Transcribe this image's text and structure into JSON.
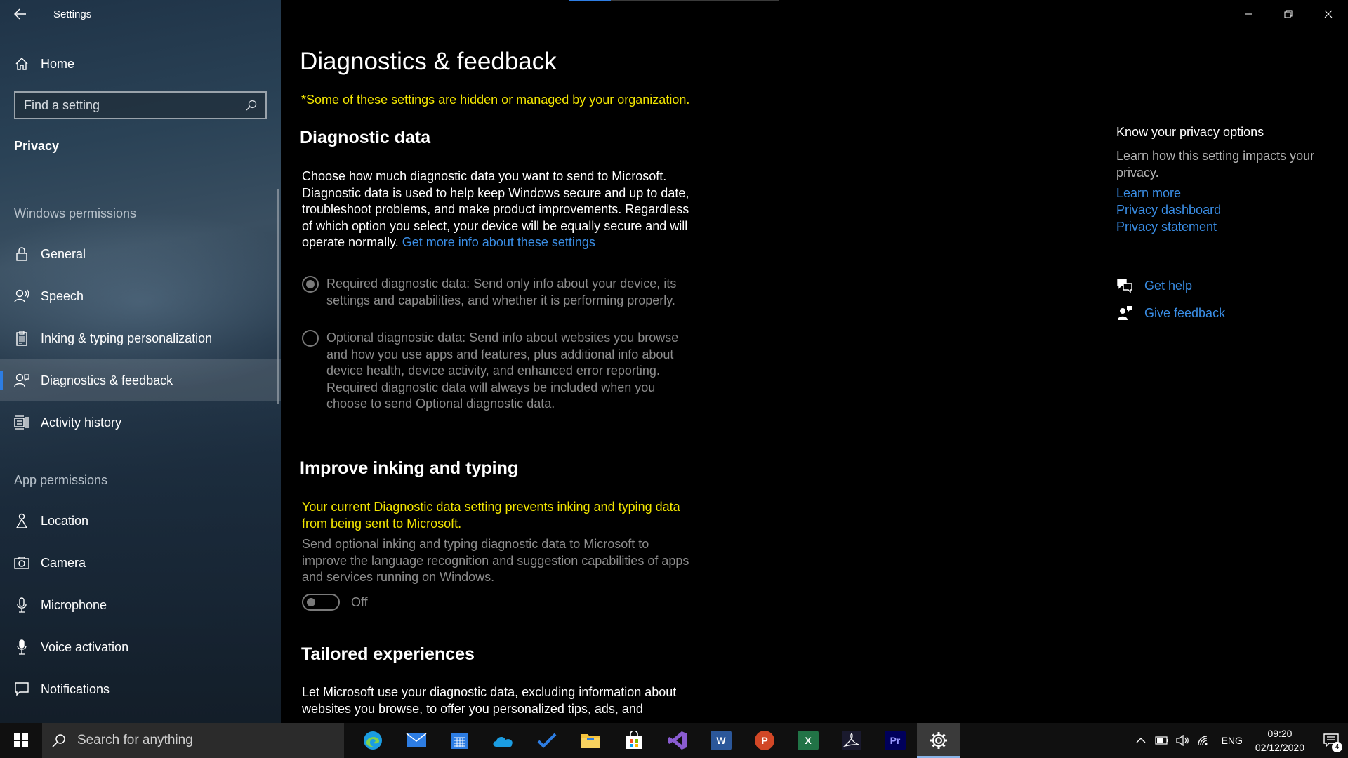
{
  "window": {
    "app_title": "Settings"
  },
  "sidebar": {
    "home_label": "Home",
    "search_placeholder": "Find a setting",
    "current_section": "Privacy",
    "group1_label": "Windows permissions",
    "group1_items": [
      {
        "label": "General",
        "icon": "lock-icon"
      },
      {
        "label": "Speech",
        "icon": "speech-icon"
      },
      {
        "label": "Inking & typing personalization",
        "icon": "clipboard-icon"
      },
      {
        "label": "Diagnostics & feedback",
        "icon": "diagnostics-icon",
        "active": true
      },
      {
        "label": "Activity history",
        "icon": "activity-history-icon"
      }
    ],
    "group2_label": "App permissions",
    "group2_items": [
      {
        "label": "Location",
        "icon": "location-icon"
      },
      {
        "label": "Camera",
        "icon": "camera-icon"
      },
      {
        "label": "Microphone",
        "icon": "microphone-icon"
      },
      {
        "label": "Voice activation",
        "icon": "voice-activation-icon"
      },
      {
        "label": "Notifications",
        "icon": "notifications-icon"
      }
    ]
  },
  "main": {
    "title": "Diagnostics & feedback",
    "managed_warning": "*Some of these settings are hidden or managed by your organization.",
    "diagnostic": {
      "heading": "Diagnostic data",
      "description": "Choose how much diagnostic data you want to send to Microsoft. Diagnostic data is used to help keep Windows secure and up to date, troubleshoot problems, and make product improvements. Regardless of which option you select, your device will be equally secure and will operate normally.",
      "info_link": "Get more info about these settings",
      "option_required": "Required diagnostic data: Send only info about your device, its settings and capabilities, and whether it is performing properly.",
      "option_optional": "Optional diagnostic data: Send info about websites you browse and how you use apps and features, plus additional info about device health, device activity, and enhanced error reporting. Required diagnostic data will always be included when you choose to send Optional diagnostic data.",
      "selected": "required"
    },
    "inking": {
      "heading": "Improve inking and typing",
      "warning": "Your current Diagnostic data setting prevents inking and typing data from being sent to Microsoft.",
      "description": "Send optional inking and typing diagnostic data to Microsoft to improve the language recognition and suggestion capabilities of apps and services running on Windows.",
      "toggle_state": "Off"
    },
    "tailored": {
      "heading": "Tailored experiences",
      "description": "Let Microsoft use your diagnostic data, excluding information about websites you browse, to offer you personalized tips, ads, and"
    }
  },
  "right_panel": {
    "title": "Know your privacy options",
    "description": "Learn how this setting impacts your privacy.",
    "links": [
      "Learn more",
      "Privacy dashboard",
      "Privacy statement"
    ],
    "get_help": "Get help",
    "give_feedback": "Give feedback"
  },
  "taskbar": {
    "search_placeholder": "Search for anything",
    "apps": [
      "Edge",
      "Mail",
      "Calendar",
      "OneDrive",
      "To Do",
      "File Explorer",
      "Store",
      "Visual Studio",
      "Word",
      "PowerPoint",
      "Excel",
      "Acrobat",
      "Premiere",
      "Settings"
    ],
    "language": "ENG",
    "time": "09:20",
    "date": "02/12/2020",
    "notification_count": "4"
  },
  "colors": {
    "accent": "#2d7de3",
    "link": "#3a8ee6",
    "warning": "#f2e500"
  }
}
